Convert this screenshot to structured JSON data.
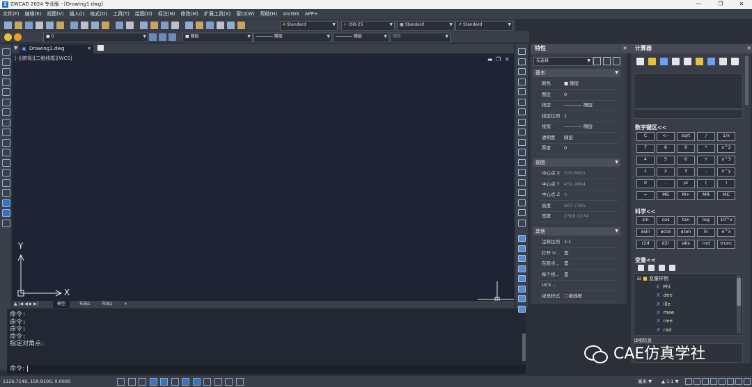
{
  "window": {
    "title": "ZWCAD 2024 专业版 - [Drawing1.dwg]",
    "logo": "Z"
  },
  "menu": [
    "文件(F)",
    "编辑(E)",
    "视图(V)",
    "插入(I)",
    "格式(O)",
    "工具(T)",
    "绘图(D)",
    "标注(N)",
    "修改(M)",
    "扩展工具(X)",
    "窗口(W)",
    "帮助(H)",
    "ArcGIS",
    "APP+"
  ],
  "toolbar": {
    "text_style": "Standard",
    "dim_style": "ISO-25",
    "table_style": "Standard",
    "mleader_style": "Standard",
    "layer": "0",
    "color": "随层",
    "linetype": "随层",
    "lineweight": "随层",
    "plot_style": "随色"
  },
  "doc_tab": {
    "label": "Drawing1.dwg"
  },
  "viewport": {
    "label": "[-][俯视][二维线框][WCS]",
    "axis_x": "X",
    "axis_y": "Y"
  },
  "layout_tabs": [
    "模型",
    "布局1",
    "布局2",
    "+"
  ],
  "command": {
    "history": [
      "命令:",
      "命令:",
      "命令:",
      "命令:",
      "指定对角点:"
    ],
    "prompt": "命令:"
  },
  "status": {
    "coords": "1126.7149,  150.9100,  0.0000",
    "unit": "毫米",
    "scale": "1:1"
  },
  "properties": {
    "title": "特性",
    "selection": "无选择",
    "sections": {
      "basic": {
        "title": "基本",
        "rows": [
          {
            "k": "颜色",
            "v": "■ 随层"
          },
          {
            "k": "图层",
            "v": "0"
          },
          {
            "k": "线型",
            "v": "———— 随层"
          },
          {
            "k": "线型比例",
            "v": "1"
          },
          {
            "k": "线宽",
            "v": "———— 随层"
          },
          {
            "k": "透明度",
            "v": "随层"
          },
          {
            "k": "厚度",
            "v": "0"
          }
        ]
      },
      "view": {
        "title": "视图",
        "rows": [
          {
            "k": "中心点 X",
            "v": "555.8901"
          },
          {
            "k": "中心点 Y",
            "v": "450.4994"
          },
          {
            "k": "中心点 Z",
            "v": "0"
          },
          {
            "k": "高度",
            "v": "607.7385"
          },
          {
            "k": "宽度",
            "v": "2368.0274"
          }
        ]
      },
      "misc": {
        "title": "其他",
        "rows": [
          {
            "k": "注释比例",
            "v": "1:1"
          },
          {
            "k": "打开 U...",
            "v": "是"
          },
          {
            "k": "在原点...",
            "v": "是"
          },
          {
            "k": "每个视...",
            "v": "是"
          },
          {
            "k": "UCS ...",
            "v": ""
          },
          {
            "k": "视觉样式",
            "v": "二维线框"
          }
        ]
      }
    }
  },
  "calculator": {
    "title": "计算器",
    "numpad_title": "数字键区<<",
    "numpad": [
      [
        "C",
        "<--",
        "sqrt",
        "/",
        "1/x"
      ],
      [
        "7",
        "8",
        "9",
        "*",
        "x^2"
      ],
      [
        "4",
        "5",
        "6",
        "+",
        "x^3"
      ],
      [
        "1",
        "2",
        "3",
        "-",
        "x^y"
      ],
      [
        "0",
        ".",
        "pi",
        "(",
        ")"
      ],
      [
        "=",
        "MS",
        "M+",
        "MR",
        "MC"
      ]
    ],
    "sci_title": "科学<<",
    "sci": [
      [
        "sin",
        "cos",
        "tan",
        "log",
        "10^x"
      ],
      [
        "asin",
        "acos",
        "atan",
        "ln",
        "e^x"
      ],
      [
        "r2d",
        "d2r",
        "abs",
        "rnd",
        "trunc"
      ]
    ],
    "var_title": "变量<<",
    "var_folder": "变量样例",
    "vars": [
      {
        "t": "k",
        "n": "Phi"
      },
      {
        "t": "X",
        "n": "dee"
      },
      {
        "t": "X",
        "n": "ille"
      },
      {
        "t": "X",
        "n": "mee"
      },
      {
        "t": "X",
        "n": "nee"
      },
      {
        "t": "X",
        "n": "rad"
      }
    ],
    "detail_title": "详细信息"
  },
  "watermark": "CAE仿真学社"
}
